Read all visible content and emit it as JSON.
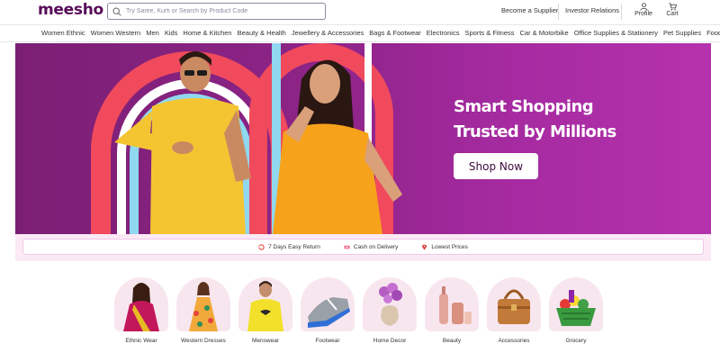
{
  "header": {
    "logo": "meesho",
    "search_placeholder": "Try Saree, Kurti or Search by Product Code",
    "become_supplier": "Become a Supplier",
    "investor_relations": "Investor Relations",
    "profile": "Profile",
    "cart": "Cart"
  },
  "categories_nav": [
    "Women Ethnic",
    "Women Western",
    "Men",
    "Kids",
    "Home & Kitchen",
    "Beauty & Health",
    "Jewellery & Accessories",
    "Bags & Footwear",
    "Electronics",
    "Sports & Fitness",
    "Car & Motorbike",
    "Office Supplies & Stationery",
    "Pet Supplies",
    "Food & Drinki"
  ],
  "hero": {
    "title_line1": "Smart Shopping",
    "title_line2": "Trusted by Millions",
    "cta": "Shop Now"
  },
  "benefits": [
    {
      "icon": "return-icon",
      "label": "7 Days Easy Return"
    },
    {
      "icon": "cash-icon",
      "label": "Cash on Delivery"
    },
    {
      "icon": "price-tag-icon",
      "label": "Lowest Prices"
    }
  ],
  "shop_categories": [
    {
      "label": "Ethnic Wear",
      "icon": "ethnic-wear-image"
    },
    {
      "label": "Western Dresses",
      "icon": "western-dress-image"
    },
    {
      "label": "Menswear",
      "icon": "menswear-image"
    },
    {
      "label": "Footwear",
      "icon": "footwear-image"
    },
    {
      "label": "Home Decor",
      "icon": "home-decor-image"
    },
    {
      "label": "Beauty",
      "icon": "beauty-image"
    },
    {
      "label": "Accessories",
      "icon": "accessories-image"
    },
    {
      "label": "Grocery",
      "icon": "grocery-image"
    }
  ],
  "colors": {
    "brand": "#570a57",
    "hero_bg": "#8e2488",
    "benefits_bg": "#fbeaf6"
  }
}
